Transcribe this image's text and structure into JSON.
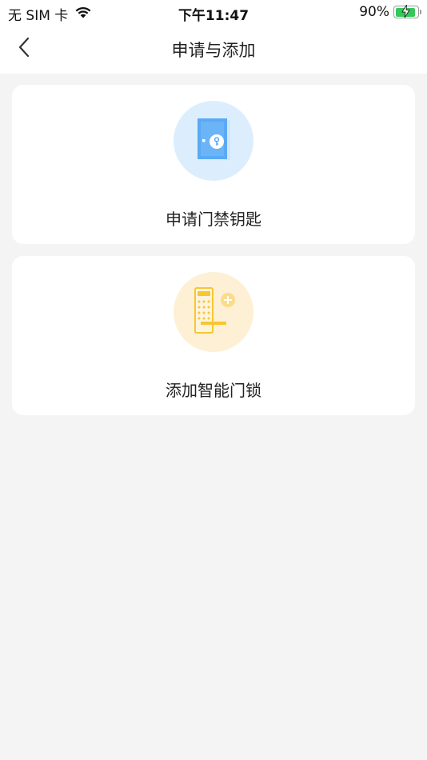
{
  "status_bar": {
    "carrier": "无 SIM 卡",
    "wifi_icon": "wifi-icon",
    "time": "下午11:47",
    "battery_percent": "90%",
    "battery_level": 0.9,
    "battery_icon": "battery-charging-icon"
  },
  "nav": {
    "back_icon": "chevron-left-icon",
    "title": "申请与添加"
  },
  "cards": [
    {
      "icon": "door-key-icon",
      "label": "申请门禁钥匙",
      "icon_bg": "#dceefd"
    },
    {
      "icon": "smart-lock-add-icon",
      "label": "添加智能门锁",
      "icon_bg": "#fdf0d4"
    }
  ],
  "colors": {
    "background": "#f4f4f4",
    "card": "#ffffff",
    "battery": "#34c759",
    "door_blue": "#5aa9f5",
    "lock_yellow": "#f9c531"
  }
}
